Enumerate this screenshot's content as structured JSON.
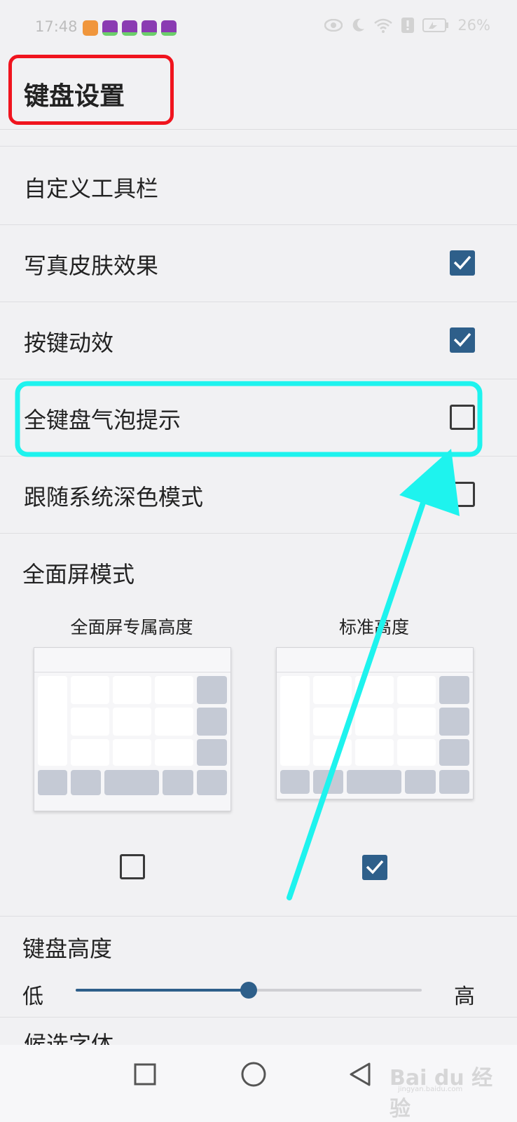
{
  "status_bar": {
    "time": "17:48",
    "battery": "26%",
    "icons": [
      "heart-app-icon",
      "game-app-icon",
      "game-app-icon",
      "game-app-icon",
      "game-app-icon",
      "eye-icon",
      "moon-icon",
      "wifi-icon",
      "alert-icon",
      "battery-icon"
    ]
  },
  "header": {
    "title": "键盘设置"
  },
  "settings": [
    {
      "label": "自定义工具栏"
    },
    {
      "label": "写真皮肤效果",
      "checked": true
    },
    {
      "label": "按键动效",
      "checked": true
    },
    {
      "label": "全键盘气泡提示",
      "checked": false
    },
    {
      "label": "跟随系统深色模式",
      "checked": false
    }
  ],
  "fullscreen": {
    "title": "全面屏模式",
    "options": [
      {
        "caption": "全面屏专属高度",
        "checked": false
      },
      {
        "caption": "标准高度",
        "checked": true
      }
    ]
  },
  "keyboard_height": {
    "title": "键盘高度",
    "low_label": "低",
    "high_label": "高",
    "value": 0.5
  },
  "candidate_font": {
    "label": "候选字体"
  },
  "nav": {
    "buttons": [
      "recents-square-icon",
      "home-circle-icon",
      "back-triangle-icon"
    ]
  },
  "watermark": {
    "text": "Bai du 经验",
    "sub": "jingyan.baidu.com"
  },
  "colors": {
    "accent": "#2e5f8a",
    "annotation_red": "#f0141e",
    "annotation_cyan": "#1ef3ee"
  }
}
